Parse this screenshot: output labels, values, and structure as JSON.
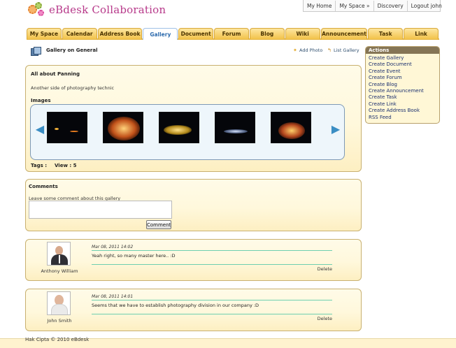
{
  "app": {
    "logo_text": "eBdesk Collaboration"
  },
  "topnav": {
    "items": [
      "My Home",
      "My Space »",
      "Discovery",
      "Logout john"
    ]
  },
  "tabs": [
    {
      "label": "My Space"
    },
    {
      "label": "Calendar"
    },
    {
      "label": "Address Book"
    },
    {
      "label": "Gallery",
      "active": true
    },
    {
      "label": "Document"
    },
    {
      "label": "Forum"
    },
    {
      "label": "Blog"
    },
    {
      "label": "Wiki"
    },
    {
      "label": "Announcement"
    },
    {
      "label": "Task"
    },
    {
      "label": "Link"
    }
  ],
  "page": {
    "title": "Gallery on General",
    "add_photo": "Add Photo",
    "list_gallery": "List Gallery"
  },
  "actions": {
    "title": "Actions",
    "items": [
      "Create Gallery",
      "Create Document",
      "Create Event",
      "Create Forum",
      "Create Blog",
      "Create Announcement",
      "Create Task",
      "Create Link",
      "Create Address Book",
      "RSS Feed"
    ]
  },
  "gallery": {
    "title": "All about Panning",
    "description": "Another side of photography technic",
    "images_label": "Images",
    "tags_label": "Tags :",
    "view_label": "View : 5",
    "thumb_count": 5
  },
  "comments": {
    "title": "Comments",
    "prompt": "Leave some comment about this gallery",
    "textarea_value": "",
    "button": "Comment",
    "entries": [
      {
        "author": "Anthony William",
        "date": "Mar 08, 2011 14:02",
        "text": "Yeah right, so many master here.. :D",
        "delete": "Delete"
      },
      {
        "author": "John Smith",
        "date": "Mar 08, 2011 14:01",
        "text": "Seems that we have to establish photography division in our company :D",
        "delete": "Delete"
      }
    ]
  },
  "footer": {
    "text": "Hak Cipta © 2010 eBdesk"
  },
  "colors": {
    "tab_gold": "#f2c24a",
    "active_tab_text": "#2f6cae",
    "panel_border": "#c8b070",
    "actions_header": "#857555",
    "link_blue": "#1a2f6e"
  }
}
